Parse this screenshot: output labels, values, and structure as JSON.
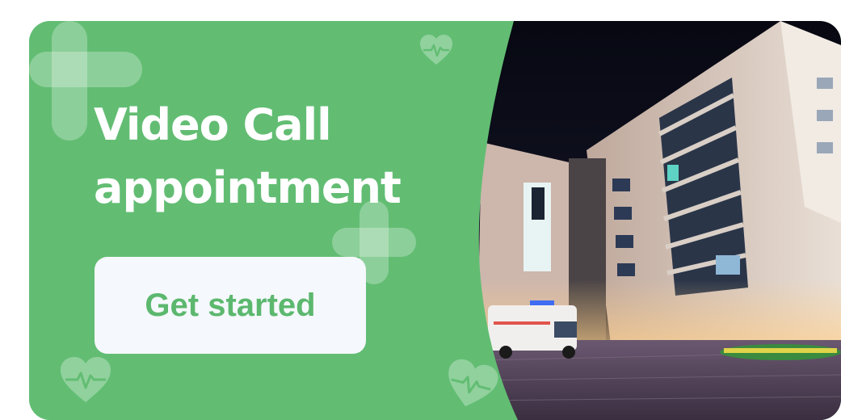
{
  "banner": {
    "title": "Video Call appointment",
    "cta_label": "Get started"
  },
  "colors": {
    "panel_green": "#62bd73",
    "button_background": "#f5f8fd",
    "button_text": "#5cb86e",
    "title_text": "#ffffff",
    "night_sky": "#0b0d1c"
  },
  "icons": [
    "plus-icon",
    "heart-pulse-icon"
  ],
  "image": {
    "subject": "hospital-building-night-photo"
  }
}
